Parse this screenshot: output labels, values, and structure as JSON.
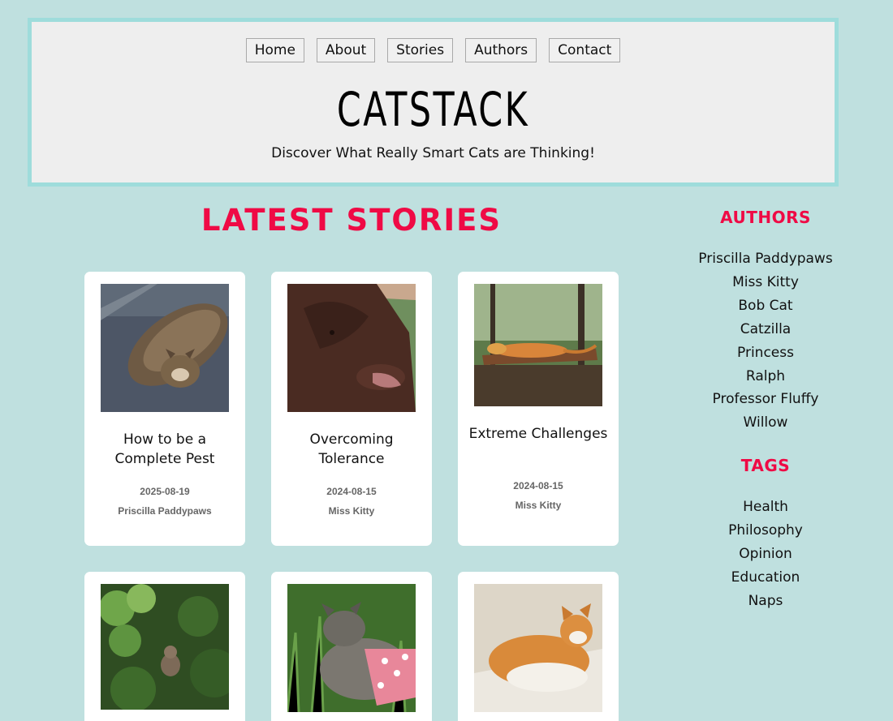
{
  "nav": {
    "items": [
      "Home",
      "About",
      "Stories",
      "Authors",
      "Contact"
    ]
  },
  "site": {
    "title": "CATSTACK",
    "tagline": "Discover What Really Smart Cats are Thinking!"
  },
  "main": {
    "heading": "LATEST STORIES",
    "stories": [
      {
        "title": "How to be a Complete Pest",
        "date": "2025-08-19",
        "author": "Priscilla Paddypaws",
        "image": "tabby-cat-on-rug"
      },
      {
        "title": "Overcoming Tolerance",
        "date": "2024-08-15",
        "author": "Miss Kitty",
        "image": "brown-dog"
      },
      {
        "title": "Extreme Challenges",
        "date": "2024-08-15",
        "author": "Miss Kitty",
        "image": "iguana-on-branch"
      },
      {
        "title": "",
        "date": "",
        "author": "",
        "image": "cat-in-ivy"
      },
      {
        "title": "",
        "date": "",
        "author": "",
        "image": "cat-in-grass-harness"
      },
      {
        "title": "",
        "date": "",
        "author": "",
        "image": "orange-white-cat"
      }
    ]
  },
  "sidebar": {
    "authors_heading": "AUTHORS",
    "authors": [
      "Priscilla Paddypaws",
      "Miss Kitty",
      "Bob Cat",
      "Catzilla",
      "Princess",
      "Ralph",
      "Professor Fluffy",
      "Willow"
    ],
    "tags_heading": "TAGS",
    "tags": [
      "Health",
      "Philosophy",
      "Opinion",
      "Education",
      "Naps"
    ]
  },
  "colors": {
    "page_bg": "#bfe0df",
    "header_border": "#9edcdb",
    "accent": "#ef0a45"
  }
}
